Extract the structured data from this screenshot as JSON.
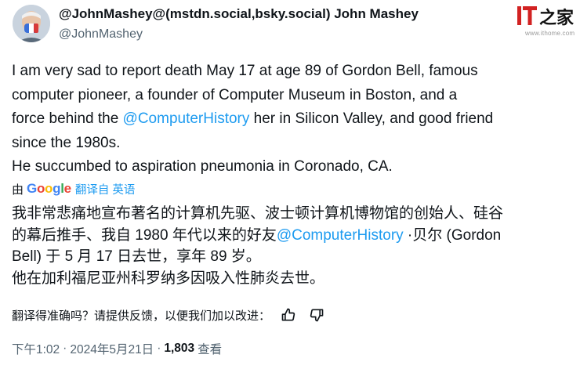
{
  "author": {
    "display_name": "@JohnMashey@(mstdn.social,bsky.social) John Mashey",
    "handle": "@JohnMashey"
  },
  "watermark": {
    "logo_text": "IT之家",
    "url": "www.ithome.com"
  },
  "tweet": {
    "line1": "I am very sad to report death May 17 at age 89  of Gordon Bell, famous",
    "line2": "computer pioneer, a founder of Computer Museum in Boston, and a",
    "line3_before": "force behind the ",
    "line3_mention": "@ComputerHistory",
    "line3_after": " her in Silicon Valley, and good friend",
    "line4": "since the 1980s.",
    "line5": "He succumbed to aspiration pneumonia in Coronado, CA."
  },
  "translation_bar": {
    "by_label": "由",
    "google_g1": "G",
    "google_o1": "o",
    "google_o2": "o",
    "google_g2": "g",
    "google_l": "l",
    "google_e": "e",
    "link_label": "翻译自 英语"
  },
  "translated": {
    "line1": "我非常悲痛地宣布著名的计算机先驱、波士顿计算机博物馆的创始人、硅谷",
    "line2_before": "的幕后推手、我自 1980 年代以来的好友",
    "line2_mention": "@ComputerHistory",
    "line2_after": " ·贝尔 (Gordon",
    "line3": "Bell) 于 5 月 17 日去世，享年 89 岁。",
    "line4": "他在加利福尼亚州科罗纳多因吸入性肺炎去世。"
  },
  "feedback": {
    "question": "翻译得准确吗？请提供反馈，以便我们加以改进：",
    "thumbs_up_icon": "thumbs-up-icon",
    "thumbs_down_icon": "thumbs-down-icon"
  },
  "meta": {
    "time": "下午1:02",
    "separator1": "·",
    "date": "2024年5月21日",
    "separator2": "·",
    "views_count": "1,803",
    "views_label": "查看"
  },
  "colors": {
    "link": "#1d9bf0",
    "text": "#0f1419",
    "muted": "#536471",
    "watermark_red": "#d22222"
  }
}
